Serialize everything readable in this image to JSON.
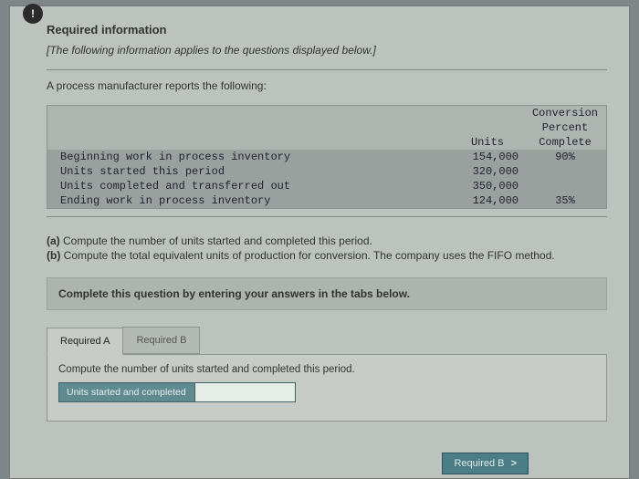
{
  "alert_glyph": "!",
  "heading": "Required information",
  "preface_italic": "[The following information applies to the questions displayed below.]",
  "lead": "A process manufacturer reports the following:",
  "table": {
    "col_units": "Units",
    "col_conv1": "Conversion",
    "col_conv2": "Percent",
    "col_conv3": "Complete",
    "rows": [
      {
        "label": "Beginning work in process inventory",
        "units": "154,000",
        "pct": "90%"
      },
      {
        "label": "Units started this period",
        "units": "320,000",
        "pct": ""
      },
      {
        "label": "Units completed and transferred out",
        "units": "350,000",
        "pct": ""
      },
      {
        "label": "Ending work in process inventory",
        "units": "124,000",
        "pct": "35%"
      }
    ]
  },
  "q_a_label": "(a)",
  "q_a_text": " Compute the number of units started and completed this period.",
  "q_b_label": "(b)",
  "q_b_text": " Compute the total equivalent units of production for conversion. The company uses the FIFO method.",
  "instruct": "Complete this question by entering your answers in the tabs below.",
  "tabs": {
    "a": "Required A",
    "b": "Required B"
  },
  "panel": {
    "prompt": "Compute the number of units started and completed this period.",
    "row_label": "Units started and completed",
    "input_value": ""
  },
  "next_btn": "Required B",
  "chevron": ">"
}
